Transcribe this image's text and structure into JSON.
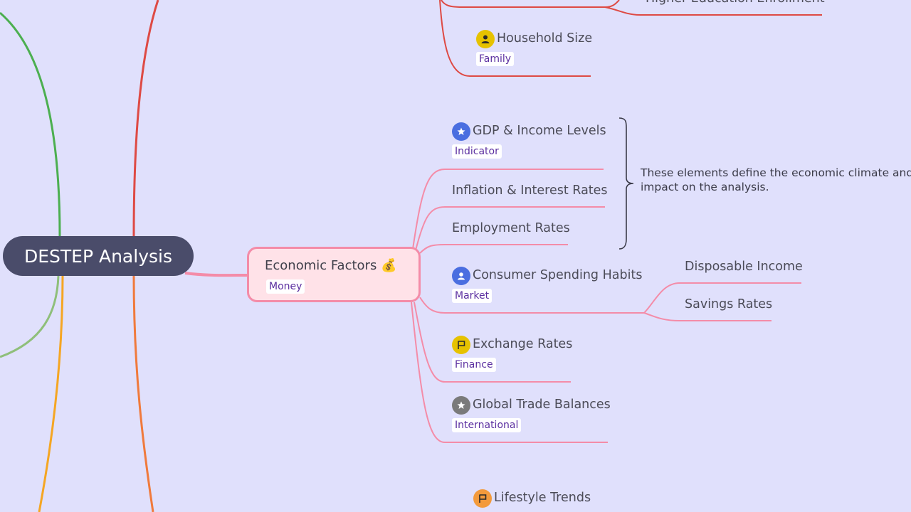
{
  "central_topic": "DESTEP Analysis",
  "top_partial": "Higher Education Enrollment",
  "household": {
    "title": "Household Size",
    "label": "Family",
    "icon": "person-icon",
    "icon_color": "#e6c200"
  },
  "economic": {
    "title": "Economic Factors 💰",
    "label": "Money",
    "items": [
      {
        "title": "GDP & Income Levels",
        "label": "Indicator",
        "icon": "star-icon",
        "icon_color": "#4a6ee0"
      },
      {
        "title": "Inflation & Interest Rates"
      },
      {
        "title": "Employment Rates"
      },
      {
        "title": "Consumer Spending Habits",
        "label": "Market",
        "icon": "person-icon",
        "icon_color": "#4a6ee0",
        "children": [
          "Disposable Income",
          "Savings Rates"
        ]
      },
      {
        "title": "Exchange Rates",
        "label": "Finance",
        "icon": "flag-icon",
        "icon_color": "#e6c200"
      },
      {
        "title": "Global Trade Balances",
        "label": "International",
        "icon": "star-icon",
        "icon_color": "#7a7a7a"
      }
    ],
    "summary": "These elements define the economic climate and its impact on the analysis."
  },
  "lifestyle": {
    "title": "Lifestyle Trends",
    "icon": "flag-icon",
    "icon_color": "#f39a3c"
  },
  "colors": {
    "background": "#e0e0fc",
    "central": "#4a4c6a",
    "economic_branch": "#f48ca8",
    "demographic_branch": "#de4a44",
    "green_branch": "#4caf50",
    "orange_branch": "#f07a3c",
    "yellow_branch": "#f5a623"
  }
}
